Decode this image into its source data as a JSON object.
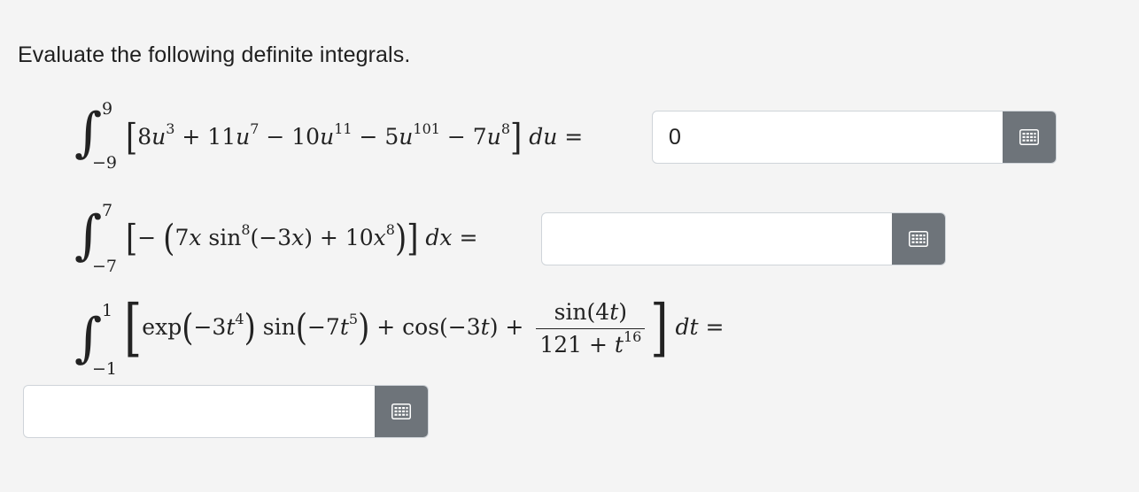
{
  "instructions": "Evaluate the following definite integrals.",
  "problems": [
    {
      "lower": "−9",
      "upper": "9",
      "answer_value": "0",
      "answer_placeholder": ""
    },
    {
      "lower": "−7",
      "upper": "7",
      "answer_value": "",
      "answer_placeholder": ""
    },
    {
      "lower": "−1",
      "upper": "1",
      "answer_value": "",
      "answer_placeholder": ""
    }
  ],
  "icons": {
    "math_palette": "keypad-icon"
  },
  "colors": {
    "page_bg": "#f4f4f4",
    "button_bg": "#6e747a",
    "input_border": "#cfd4d9"
  }
}
